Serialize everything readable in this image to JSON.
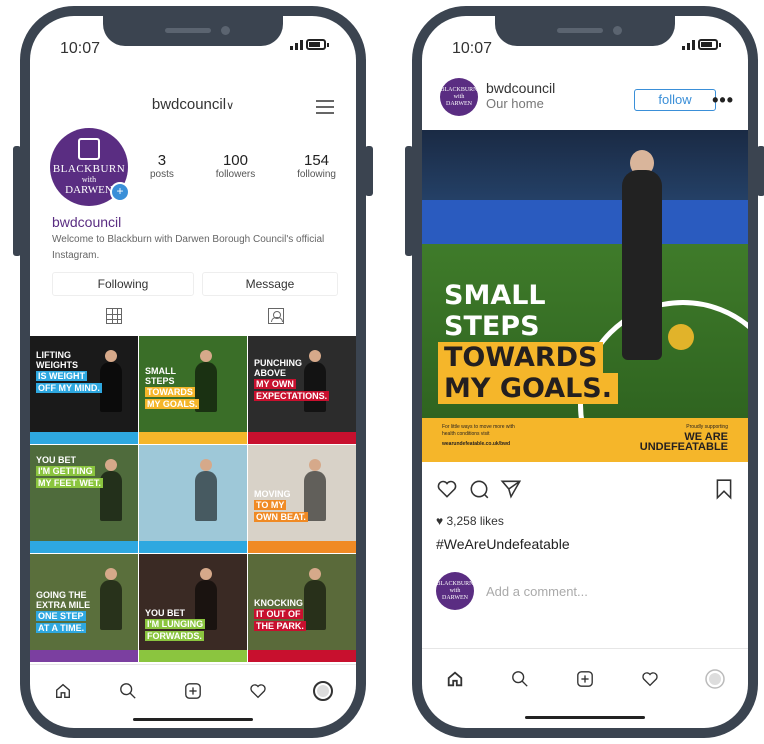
{
  "left_phone": {
    "time": "10:07",
    "header": {
      "username": "bwdcouncil",
      "chevron": "chevron-down-icon"
    },
    "avatar": {
      "line1": "BLACKBURN",
      "line2": "with",
      "line3": "DARWEN"
    },
    "stats": [
      {
        "value": "3",
        "label": "posts"
      },
      {
        "value": "100",
        "label": "followers"
      },
      {
        "value": "154",
        "label": "following"
      }
    ],
    "name": "bwdcouncil",
    "bio": "Welcome to Blackburn with Darwen Borough Council's official Instagram.",
    "buttons": {
      "following": "Following",
      "message": "Message"
    },
    "tiles": [
      {
        "lines_white": [
          "LIFTING",
          "WEIGHTS"
        ],
        "lines_hl": [
          "IS WEIGHT",
          "OFF MY MIND."
        ],
        "hl": "#2ea8e0",
        "bg": "#1a1a1a",
        "strip": "#2ea8e0"
      },
      {
        "lines_white": [
          "SMALL",
          "STEPS"
        ],
        "lines_hl": [
          "TOWARDS",
          "MY GOALS."
        ],
        "hl": "#f5b62a",
        "bg": "#3a6e28",
        "strip": "#f5b62a"
      },
      {
        "lines_white": [
          "PUNCHING",
          "ABOVE"
        ],
        "lines_hl": [
          "MY OWN",
          "EXPECTATIONS."
        ],
        "hl": "#c8102e",
        "bg": "#2c2c2c",
        "strip": "#c8102e"
      },
      {
        "lines_white": [
          "YOU BET"
        ],
        "lines_hl": [
          "I'M GETTING",
          "MY FEET WET."
        ],
        "hl": "#8bc53f",
        "bg": "#4f6b3c",
        "strip": "#2ea8e0"
      },
      {
        "lines_white": [],
        "lines_hl": [],
        "hl": "#2ea8e0",
        "bg": "#9ec8d8",
        "strip": "#2ea8e0"
      },
      {
        "lines_white": [
          "MOVING"
        ],
        "lines_hl": [
          "TO MY",
          "OWN BEAT."
        ],
        "hl": "#f08a24",
        "bg": "#d8d2c8",
        "strip": "#f08a24"
      },
      {
        "lines_white": [
          "GOING THE",
          "EXTRA MILE"
        ],
        "lines_hl": [
          "ONE STEP",
          "AT A TIME."
        ],
        "hl": "#2ea8e0",
        "bg": "#5a6f3c",
        "strip": "#7b3fa0"
      },
      {
        "lines_white": [
          "YOU BET"
        ],
        "lines_hl": [
          "I'M LUNGING",
          "FORWARDS."
        ],
        "hl": "#8bc53f",
        "bg": "#3a2a24",
        "strip": "#8bc53f"
      },
      {
        "lines_white": [
          "KNOCKING"
        ],
        "lines_hl": [
          "IT OUT OF",
          "THE PARK."
        ],
        "hl": "#c8102e",
        "bg": "#5a6a3a",
        "strip": "#c8102e"
      }
    ]
  },
  "right_phone": {
    "time": "10:07",
    "post": {
      "username": "bwdcouncil",
      "location": "Our home",
      "follow_label": "follow",
      "more": "•••",
      "avatar_text": "BLACKBURN with DARWEN",
      "headline_white": [
        "SMALL",
        "STEPS"
      ],
      "headline_yellow": [
        "TOWARDS",
        "MY GOALS."
      ],
      "footer_small": [
        "For little ways to move more with",
        "health conditions visit",
        "wearundefeatable.co.uk/bwd"
      ],
      "footer_proudly": "Proudly supporting",
      "footer_brand": [
        "WE ARE",
        "UNDEFEATABLE"
      ],
      "likes": "3,258 likes",
      "hashtag": "#WeAreUndefeatable",
      "comment_placeholder": "Add a comment..."
    }
  },
  "colors": {
    "purple": "#5a2d82",
    "yellow": "#f5b62a",
    "blue": "#3a8fd8",
    "frame": "#3b4450"
  },
  "tab_icons": [
    "home-icon",
    "search-icon",
    "add-icon",
    "heart-icon",
    "profile-icon"
  ]
}
